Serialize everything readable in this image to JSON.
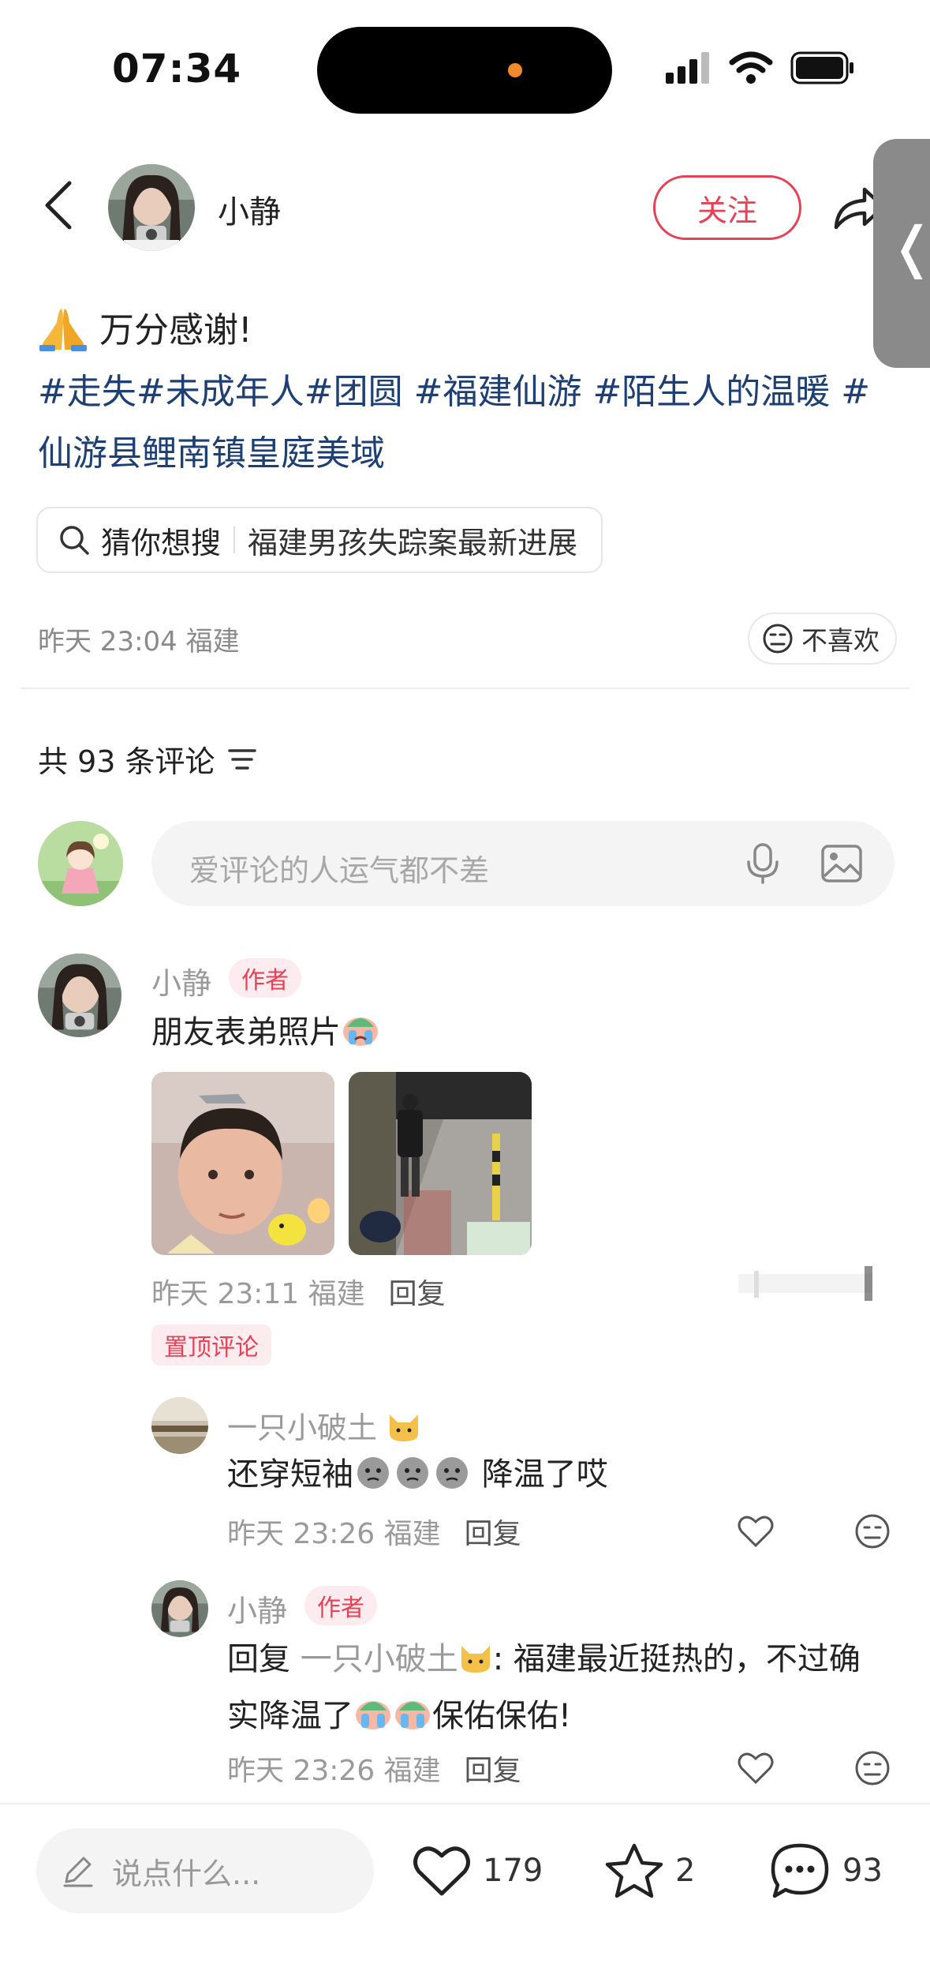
{
  "status_bar": {
    "time": "07:34"
  },
  "header": {
    "author": "小静",
    "follow_label": "关注"
  },
  "post": {
    "title": "万分感谢!",
    "hashtags": "#走失#未成年人#团圆 #福建仙游 #陌生人的温暖 #仙游县鲤南镇皇庭美域",
    "search_label": "猜你想搜",
    "search_query": "福建男孩失踪案最新进展",
    "meta": "昨天 23:04 福建",
    "dislike_label": "不喜欢"
  },
  "comments_header": {
    "count_text": "共 93 条评论"
  },
  "comment_input": {
    "placeholder": "爱评论的人运气都不差"
  },
  "comments": [
    {
      "name": "小静",
      "badge": "作者",
      "text": "朋友表弟照片",
      "meta": "昨天 23:11 福建",
      "reply": "回复",
      "pinned": "置顶评论"
    },
    {
      "name": "一只小破土",
      "text_a": "还穿短袖",
      "text_b": "降温了哎",
      "meta": "昨天 23:26 福建",
      "reply": "回复"
    },
    {
      "name": "小静",
      "badge": "作者",
      "reply_prefix": "回复",
      "reply_to": "一只小破土",
      "text_a": ": 福建最近挺热的，不过确",
      "text_b": "实降温了",
      "text_c": "保佑保佑!",
      "meta": "昨天 23:26 福建",
      "reply": "回复"
    }
  ],
  "bottom_bar": {
    "input_placeholder": "说点什么...",
    "likes": "179",
    "favorites": "2",
    "comments": "93"
  },
  "colors": {
    "accent": "#e64155",
    "hashtag": "#1d3f73"
  }
}
